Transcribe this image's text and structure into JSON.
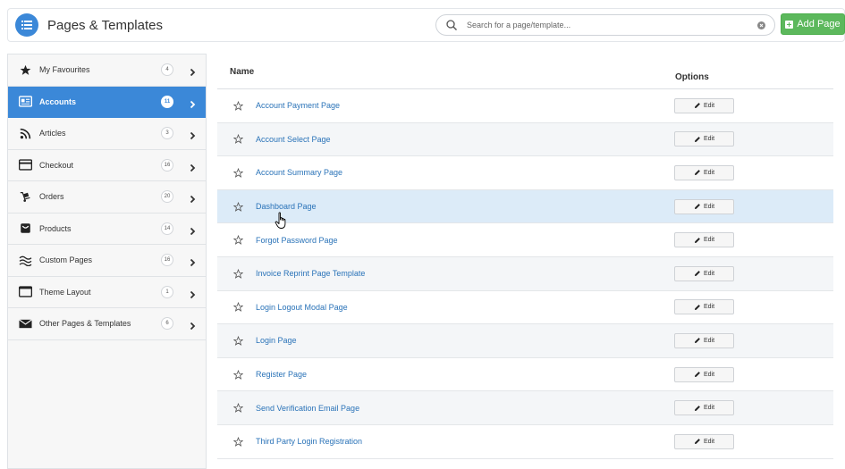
{
  "header": {
    "title": "Pages & Templates",
    "icon": "list-icon",
    "search_placeholder": "Search for a page/template...",
    "add_label": "Add Page"
  },
  "colors": {
    "accent": "#3b88d8",
    "add_green": "#5cb85c",
    "link": "#2a73b8",
    "row_hover": "#dcebf8"
  },
  "sidebar": {
    "items": [
      {
        "label": "My Favourites",
        "count": "4",
        "icon": "star-icon",
        "active": false
      },
      {
        "label": "Accounts",
        "count": "11",
        "icon": "id-card-icon",
        "active": true
      },
      {
        "label": "Articles",
        "count": "3",
        "icon": "rss-icon",
        "active": false
      },
      {
        "label": "Checkout",
        "count": "16",
        "icon": "credit-card-icon",
        "active": false
      },
      {
        "label": "Orders",
        "count": "20",
        "icon": "truck-icon",
        "active": false
      },
      {
        "label": "Products",
        "count": "14",
        "icon": "box-icon",
        "active": false
      },
      {
        "label": "Custom Pages",
        "count": "16",
        "icon": "wave-icon",
        "active": false
      },
      {
        "label": "Theme Layout",
        "count": "1",
        "icon": "window-icon",
        "active": false
      },
      {
        "label": "Other Pages & Templates",
        "count": "6",
        "icon": "envelope-icon",
        "active": false
      }
    ]
  },
  "table": {
    "col_name": "Name",
    "col_options": "Options",
    "edit_label": "Edit",
    "rows": [
      {
        "name": "Account Payment Page"
      },
      {
        "name": "Account Select Page"
      },
      {
        "name": "Account Summary Page"
      },
      {
        "name": "Dashboard Page",
        "hover": true
      },
      {
        "name": "Forgot Password Page"
      },
      {
        "name": "Invoice Reprint Page Template"
      },
      {
        "name": "Login Logout Modal Page"
      },
      {
        "name": "Login Page"
      },
      {
        "name": "Register Page"
      },
      {
        "name": "Send Verification Email Page"
      },
      {
        "name": "Third Party Login Registration"
      }
    ]
  }
}
